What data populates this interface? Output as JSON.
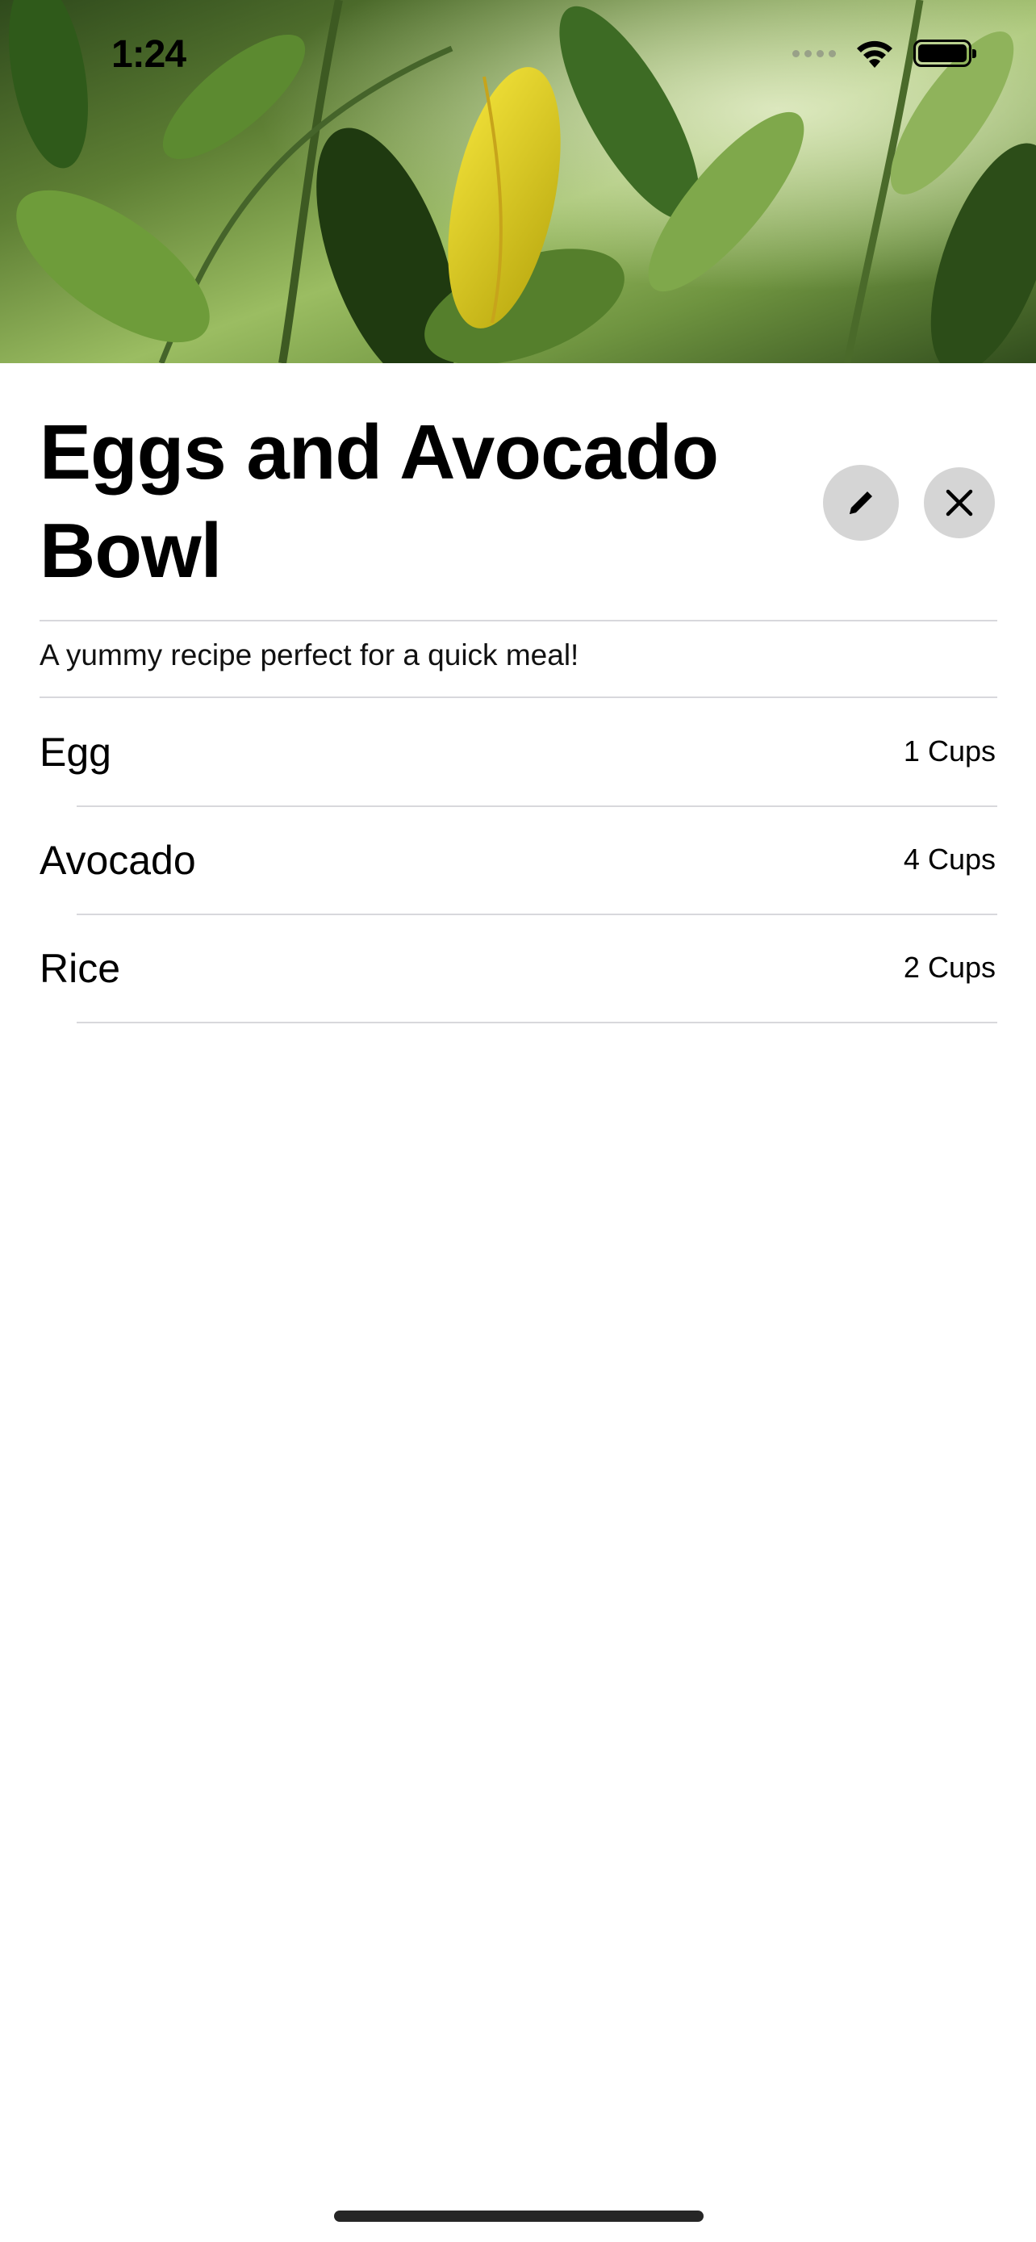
{
  "status_bar": {
    "time": "1:24",
    "icons": [
      "cellular-icon",
      "wifi-icon",
      "battery-icon"
    ]
  },
  "hero_image": {
    "description_icon": "plant-photo"
  },
  "recipe": {
    "title": "Eggs and Avocado Bowl",
    "description": "A yummy recipe perfect for a quick meal!",
    "ingredients": [
      {
        "name": "Egg",
        "quantity": "1 Cups"
      },
      {
        "name": "Avocado",
        "quantity": "4 Cups"
      },
      {
        "name": "Rice",
        "quantity": "2 Cups"
      }
    ]
  },
  "actions": {
    "edit_icon": "pencil-icon",
    "close_icon": "close-icon"
  },
  "colors": {
    "button_background": "#d5d5d5",
    "separator": "#d8d8dc",
    "text": "#000000"
  }
}
